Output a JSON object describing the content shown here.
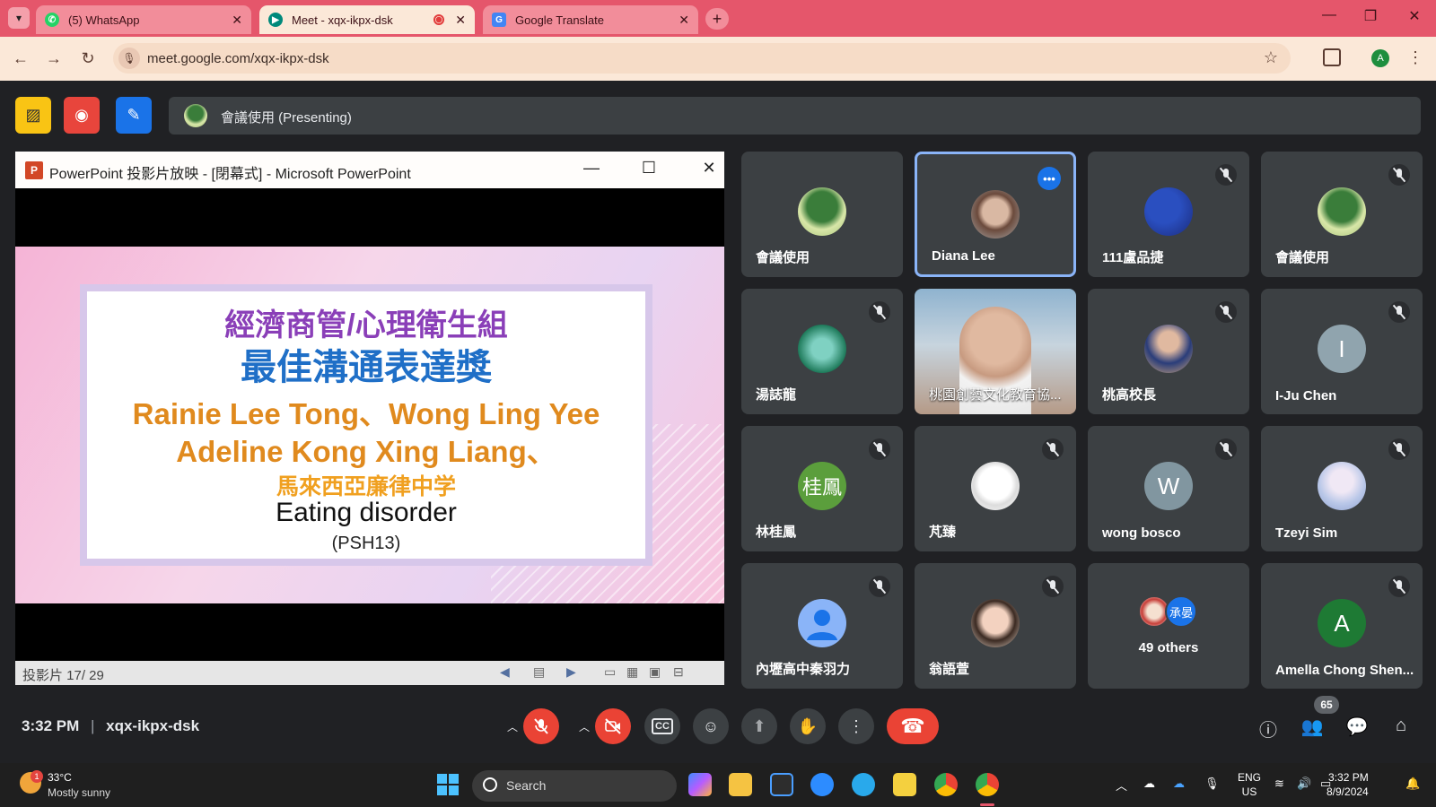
{
  "browser": {
    "tabs": [
      {
        "title": "(5) WhatsApp",
        "icon": "whatsapp-icon",
        "color": "#25d366"
      },
      {
        "title": "Meet - xqx-ikpx-dsk",
        "icon": "meet-icon",
        "color": "#00897b"
      },
      {
        "title": "Google Translate",
        "icon": "translate-icon",
        "color": "#4285f4"
      }
    ],
    "url": "meet.google.com/xqx-ikpx-dsk",
    "profile_initial": "A"
  },
  "meet": {
    "presenting_label": "會議使用 (Presenting)",
    "time": "3:32 PM",
    "meeting_code": "xqx-ikpx-dsk",
    "participant_count": "65",
    "others_label": "49 others",
    "others_badge": "承晏",
    "participants": [
      {
        "name": "會議使用",
        "avatar": "photo",
        "muted": false
      },
      {
        "name": "Diana Lee",
        "avatar": "photo",
        "muted": false,
        "speaking": true
      },
      {
        "name": "111盧品捷",
        "avatar": "photo",
        "muted": true
      },
      {
        "name": "會議使用",
        "avatar": "photo",
        "muted": true
      },
      {
        "name": "湯誌龍",
        "avatar": "photo",
        "muted": true
      },
      {
        "name": "桃園創藝文化教育協...",
        "avatar": "video",
        "muted": false
      },
      {
        "name": "桃高校長",
        "avatar": "photo",
        "muted": true
      },
      {
        "name": "I-Ju Chen",
        "avatar_letter": "I",
        "avatar_color": "#90a4ae",
        "muted": true
      },
      {
        "name": "林桂鳳",
        "avatar_letter": "桂鳳",
        "avatar_color": "#5b9e3c",
        "muted": true
      },
      {
        "name": "芃臻",
        "avatar": "photo",
        "muted": true
      },
      {
        "name": "wong bosco",
        "avatar_letter": "W",
        "avatar_color": "#8196a0",
        "muted": true
      },
      {
        "name": "Tzeyi Sim",
        "avatar": "photo",
        "muted": true
      },
      {
        "name": "內壢高中秦羽力",
        "avatar": "default",
        "muted": true
      },
      {
        "name": "翁語萱",
        "avatar": "photo",
        "muted": true
      },
      {
        "name": "Amella Chong Shen...",
        "avatar_letter": "A",
        "avatar_color": "#1e7a34",
        "muted": true
      }
    ]
  },
  "ppt": {
    "window_title": "PowerPoint 投影片放映 - [閉幕式] - Microsoft PowerPoint",
    "slide_status": "投影片 17/ 29",
    "slide": {
      "line1": "經濟商管/心理衛生組",
      "line2": "最佳溝通表達獎",
      "line3": "Rainie Lee Tong、Wong Ling Yee",
      "line4": "Adeline Kong Xing Liang、",
      "line5": "馬來西亞廉律中学",
      "line6": "Eating disorder",
      "line7": "(PSH13)"
    }
  },
  "taskbar": {
    "weather_badge": "1",
    "temperature": "33°C",
    "condition": "Mostly sunny",
    "search_label": "Search",
    "lang_line1": "ENG",
    "lang_line2": "US",
    "clock_time": "3:32 PM",
    "clock_date": "8/9/2024"
  },
  "colors": {
    "tab_strip": "#e5566b",
    "meet_bg": "#202124",
    "tile_bg": "#3c4043",
    "end_call": "#ea4335",
    "speaking_border": "#8ab4f8",
    "slide_purple": "#8a3fb8",
    "slide_blue": "#1f6fc7",
    "slide_orange": "#e08a1e"
  }
}
